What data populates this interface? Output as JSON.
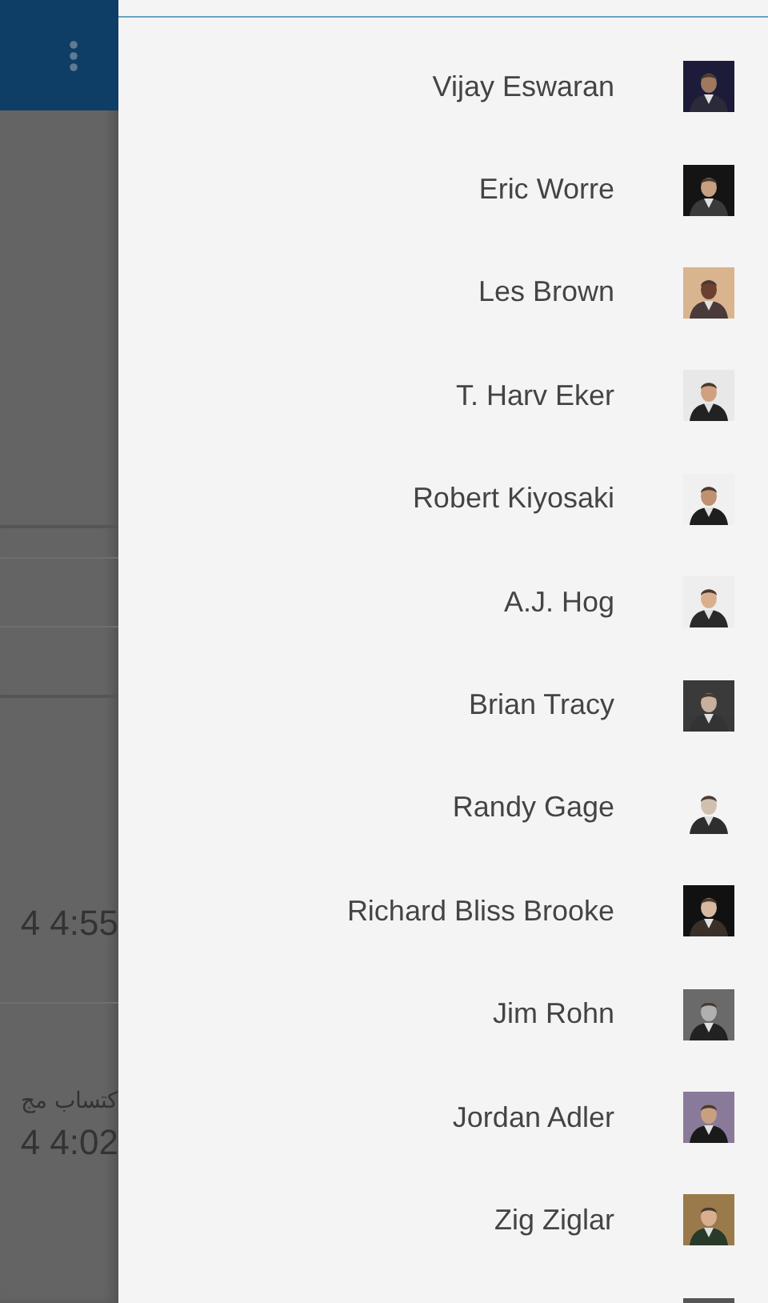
{
  "background": {
    "rows": [
      {
        "text": "4 4:55"
      },
      {
        "text": "كتساب مج"
      },
      {
        "text": "4 4:02"
      }
    ]
  },
  "drawer": {
    "items": [
      {
        "name": "Vijay Eswaran"
      },
      {
        "name": "Eric Worre"
      },
      {
        "name": "Les Brown"
      },
      {
        "name": "T. Harv Eker"
      },
      {
        "name": "Robert Kiyosaki"
      },
      {
        "name": "A.J. Hog"
      },
      {
        "name": "Brian Tracy"
      },
      {
        "name": "Randy Gage"
      },
      {
        "name": "Richard Bliss Brooke"
      },
      {
        "name": "Jim Rohn"
      },
      {
        "name": "Jordan Adler"
      },
      {
        "name": "Zig Ziglar"
      }
    ]
  }
}
